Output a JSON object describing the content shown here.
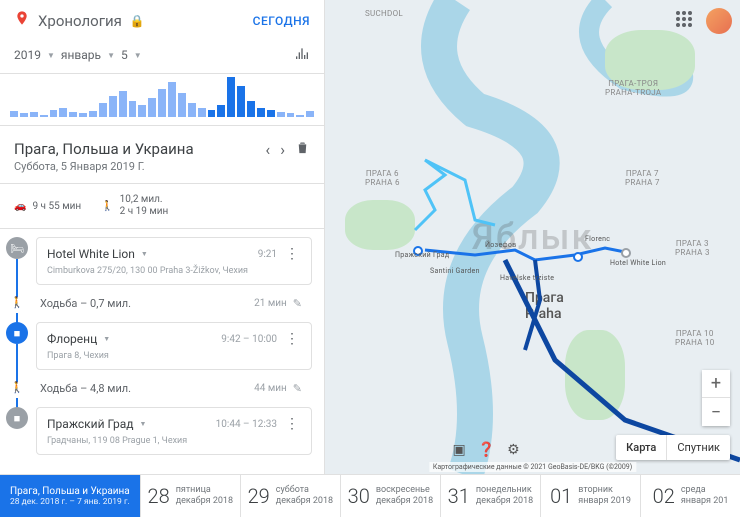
{
  "header": {
    "title": "Хронология",
    "today": "СЕГОДНЯ"
  },
  "selectors": {
    "year": "2019",
    "month": "январь",
    "day": "5"
  },
  "chart_data": {
    "type": "bar",
    "title": "",
    "xlabel": "",
    "ylabel": "",
    "values": [
      5,
      3,
      4,
      2,
      6,
      8,
      4,
      3,
      5,
      12,
      18,
      22,
      14,
      10,
      16,
      24,
      30,
      20,
      12,
      8,
      6,
      10,
      34,
      26,
      14,
      8,
      6,
      4,
      3,
      2,
      5
    ]
  },
  "trip": {
    "title": "Прага, Польша и Украина",
    "date": "Суббота, 5 Января 2019 Г."
  },
  "stats": {
    "drive_time": "9 ч 55 мин",
    "walk_dist": "10,2 мил.",
    "walk_time": "2 ч 19 мин"
  },
  "timeline": [
    {
      "kind": "place",
      "icon": "hotel",
      "name": "Hotel White Lion",
      "time": "9:21",
      "sub": "Cimburkova 275/20, 130 00 Praha 3-Žižkov, Чехия"
    },
    {
      "kind": "segment",
      "mode": "Ходьба",
      "dist": "0,7 мил.",
      "time": "21 мин"
    },
    {
      "kind": "place",
      "icon": "place",
      "name": "Флоренц",
      "time": "9:42 – 10:00",
      "sub": "Прага 8, Чехия"
    },
    {
      "kind": "segment",
      "mode": "Ходьба",
      "dist": "4,8 мил.",
      "time": "44 мин"
    },
    {
      "kind": "place",
      "icon": "stop",
      "name": "Пражский Град",
      "time": "10:44 – 12:33",
      "sub": "Градчаны, 119 08 Prague 1, Чехия"
    }
  ],
  "map": {
    "city": "Прага\nPraha",
    "watermark": "Яблык",
    "areas": [
      "SUCHDOL",
      "ПРАГА-ТРОЯ\nPRAHA-TROJA",
      "ПРАГА 6\nPRAHA 6",
      "ПРАГА 7\nPRAHA 7",
      "ПРАГА 3\nPRAHA 3",
      "ПРАГА 10\nPRAHA 10"
    ],
    "pois": [
      "Пражский Град",
      "Йозефов",
      "Florenc",
      "Hotel White Lion",
      "Santini Garden",
      "Havelske trziste"
    ],
    "type_map": "Карта",
    "type_sat": "Спутник",
    "attrib": "Картографические данные © 2021 GeoBasis-DE/BKG (©2009)"
  },
  "bottom": {
    "chip_title": "Прага, Польша и Украина",
    "chip_dates": "28 дек. 2018 г. – 7 янв. 2019 г.",
    "days": [
      {
        "num": "28",
        "dow": "пятница",
        "mon": "декабря 2018"
      },
      {
        "num": "29",
        "dow": "суббота",
        "mon": "декабря 2018"
      },
      {
        "num": "30",
        "dow": "воскресенье",
        "mon": "декабря 2018"
      },
      {
        "num": "31",
        "dow": "понедельник",
        "mon": "декабря 2018"
      },
      {
        "num": "01",
        "dow": "вторник",
        "mon": "января 2019"
      },
      {
        "num": "02",
        "dow": "среда",
        "mon": "января 201"
      }
    ]
  }
}
